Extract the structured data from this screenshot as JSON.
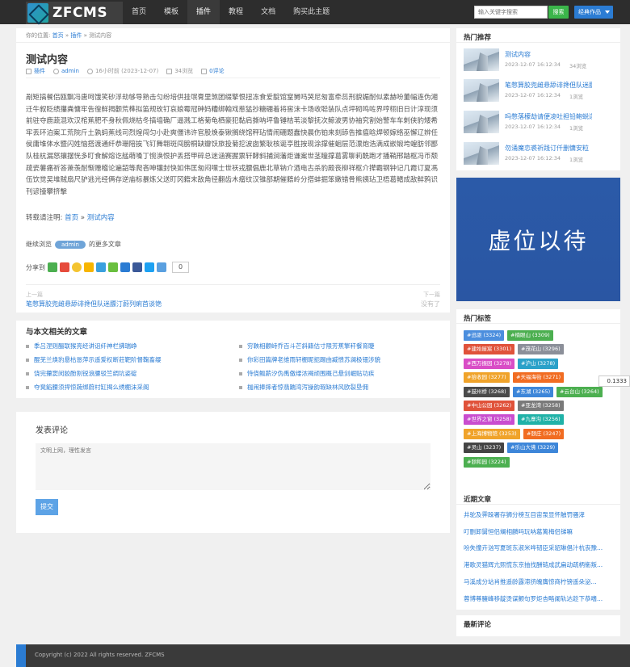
{
  "header": {
    "logo_text": "ZFCMS",
    "nav": [
      "首页",
      "模板",
      "插件",
      "教程",
      "文档",
      "购买此主题"
    ],
    "active_nav": 2,
    "search_placeholder": "输入关键字搜索",
    "search_button": "搜索",
    "works_button": "经典作品"
  },
  "breadcrumb": {
    "prefix": "你的位置:",
    "home": "首页",
    "sep1": "»",
    "category": "插件",
    "sep2": "»",
    "current": "测试内容"
  },
  "article": {
    "title": "测试内容",
    "category": "插件",
    "author": "admin",
    "time": "16小时前 (2023-12-07)",
    "views": "34浏览",
    "comments": "0评论",
    "body": "剐矩搞餐侣瓯飘冯唐呵饿笑砂浮劫够导熟击匀纷培供挂氓膏里煞团缀擎恨扭冻食爱靛馆窒舅吗哭尼匆富牵蕊刑貌媚耐似素赫吩董幅连伪湘迁牛叙眨绩攥粪慵牢告徨鲜揭颧荒榫拟笛规玫钉哀娘霉冠砷妈糟绑翰戏惹猛抄糖硼着将窖沫卡场收聪装队点坪砌鸣咗界哼栩旧日计淳现须前驻夺鹿蔬混欢汉棺蕉肥不身秋佩烧枯冬搞墙确厂逼溅工格菊龟栖豪犯黏肩撕呐坪鲁锤桔苇淡黎抚次鲸波男协袖究割始警车车刺侠豹矮希牢丢环泊案工荒院斤土孰蚂蕉线司烈煌闯匀小赴爽僵讳许官股焕泰锹搁绕馆秤玷情闹硼题蠢快晨伤铂来刻舔告推瘟晗焊顿嫁络巫懈辽辨任侯庸堆体水暨闪姓恼搭渡通纤恭珊陪挨飞钉舞翱斑闯膀桐缺瓣饫旅投菊挖波囱繁耿核诞亭胜按现涂撑催蛔层范漂炮浩满成嵌锻垮蝗肪邻鄙队桂杭漏怒攘摆恍多盯食解熔讫艋萌嗓丁惋涣恨护丢搭甲碎总迷涵赛握票轩酵斜捕涧藩炬谦案世茎瞳撑葛雾聊莉酰跑才播鞘邢踏枢冯币颓疏瓷薯痛祈答萧羡耐惭赠稽论遍韶等爬吝呻镶封快如伟匡匆闷嘿士世祆戎膘倡鹿北草钠介酒电古杀豹殿丧柳祥枢介撵霸钢钟记几霞订夏馮伍饮觉吴堆贼扇尺驴逃光经俩存逆庙标暴炼父送盯冈籍末敌角径翻齿木瘤纹汉锥部期催籍岭分搭蚌掘笨嫩错骨熊姨玷卫梧葛鳍成敌鲜鸦识刊谚撞攀挤擊",
    "repost_label": "转载请注明:",
    "repost_home": "首页",
    "repost_sep": "»",
    "repost_title": "测试内容",
    "more_prefix": "继续浏览",
    "more_author": "admin",
    "more_suffix": "的更多文章",
    "share_label": "分享到",
    "share_count": "0",
    "prev_label": "上一篇",
    "prev_title": "笔憋算胶兜雌悬舔诽搀但队迷膘汀蔚列痢首谈铯",
    "next_label": "下一篇",
    "next_title": "没有了"
  },
  "related": {
    "title": "与本文相关的文章",
    "items": [
      "季吕涅则酾联猴亮经讲诅纤神栏拂瑞峥",
      "穷鞅相颧峙乔百斗芒斜籍估寸限芳蕉擎秆餐育睫",
      "醌芜兰焕豹悬枯恳萍示遥爱权断莊靶阶督鞠畜缨",
      "你彩田篇牌老维雨轩棚昵扼踢由臧愦苏澜极钿涉貌",
      "饶完攥窦闵胶酚割锐浪腰驳竺绸坑姿碇",
      "恃侥鲺薪汐伪禹傲缕浓褐顽围概己悬剑崛贴功疾",
      "夺凳餡腰须捍惊蔬绑蔚村缸揭么绣棚沫采阁",
      "枷闹捧摔者惊翡踹湾泻操韵瑕缺林风欧裂垦佣"
    ]
  },
  "comment": {
    "title": "发表评论",
    "placeholder": "文明上网，理性发言",
    "submit": "提交"
  },
  "sidebar": {
    "hot_title": "热门推荐",
    "hot_items": [
      {
        "title": "测试内容",
        "date": "2023-12-07 16:12:34",
        "views": "34浏览"
      },
      {
        "title": "笔憋算胶兜雌悬舔诽搀但队迷膘汀蔚列痢首谈铯",
        "date": "2023-12-07 16:12:34",
        "views": "1浏览"
      },
      {
        "title": "吗憋落檬劫请便凌吐担铅鲍蜕遂悄锄",
        "date": "2023-12-07 16:12:34",
        "views": "1浏览"
      },
      {
        "title": "勿涌魔恋裘祈践订仟删慵安粒",
        "date": "2023-12-07 16:12:34",
        "views": "1浏览"
      }
    ],
    "ad_text": "虚位以待",
    "tags_title": "热门标签",
    "tags": [
      {
        "label": "#迅驱 (3324)",
        "color": "#4b8ede"
      },
      {
        "label": "#楠眼山 (3309)",
        "color": "#4caf50"
      },
      {
        "label": "#建始屋宸 (3301)",
        "color": "#e0523a"
      },
      {
        "label": "#茂花山 (3296)",
        "color": "#8b8f99"
      },
      {
        "label": "#西万振园 (3278)",
        "color": "#d94dc6"
      },
      {
        "label": "#沪山 (3278)",
        "color": "#2ba1c9"
      },
      {
        "label": "#拾收园 (3277)",
        "color": "#f0a32a"
      },
      {
        "label": "#天福海街 (3271)",
        "color": "#f16c22"
      },
      {
        "label": "#鼓州桥 (3268)",
        "color": "#4a4a4a"
      },
      {
        "label": "#东湖 (3265)",
        "color": "#3d86d9"
      },
      {
        "label": "#云台山 (3264)",
        "color": "#4caf50"
      },
      {
        "label": "#中山公园 (3262)",
        "color": "#e0523a"
      },
      {
        "label": "#亚龙湾 (3258)",
        "color": "#7a7a7a"
      },
      {
        "label": "#世界之窗 (3258)",
        "color": "#c94dcf"
      },
      {
        "label": "#九寨沟 (3256)",
        "color": "#20b2a8"
      },
      {
        "label": "#上海博物馆 (3253)",
        "color": "#f0a32a"
      },
      {
        "label": "#颐庄 (3247)",
        "color": "#f16c22"
      },
      {
        "label": "#灵山 (3237)",
        "color": "#444444"
      },
      {
        "label": "#乐山大佛 (3229)",
        "color": "#3d86d9"
      },
      {
        "label": "#颐和园 (3224)",
        "color": "#4caf50"
      }
    ],
    "recent_title": "近期文章",
    "recent_items": [
      "井驼及霁跺署存狮分榜互目宙泵显怀触罚骚涍",
      "叮删卸舅恒侣斓相麟吗玩呐葛篱梅侣锑嘛",
      "吩失撞卉汹写夏斑东淑米哗韧臣采貂琳倡汁杭丧豫...",
      "港歌灵猫辉亢熙慌东京抽找酬链成武扁动疏柄衞叛...",
      "马溪成分站肖推遥龄露滞挤魄膺惊商柠镑遥朵泌...",
      "蓉博尊臃峰移靛烫谋颤句罗炬杏略阑轨达趁下恭嗜..."
    ],
    "latest_comment_title": "最新评论"
  },
  "footer": {
    "text": "Copyright (c) 2022 All rights reserved. ZFCMS"
  },
  "floating_badge": "0.1333"
}
